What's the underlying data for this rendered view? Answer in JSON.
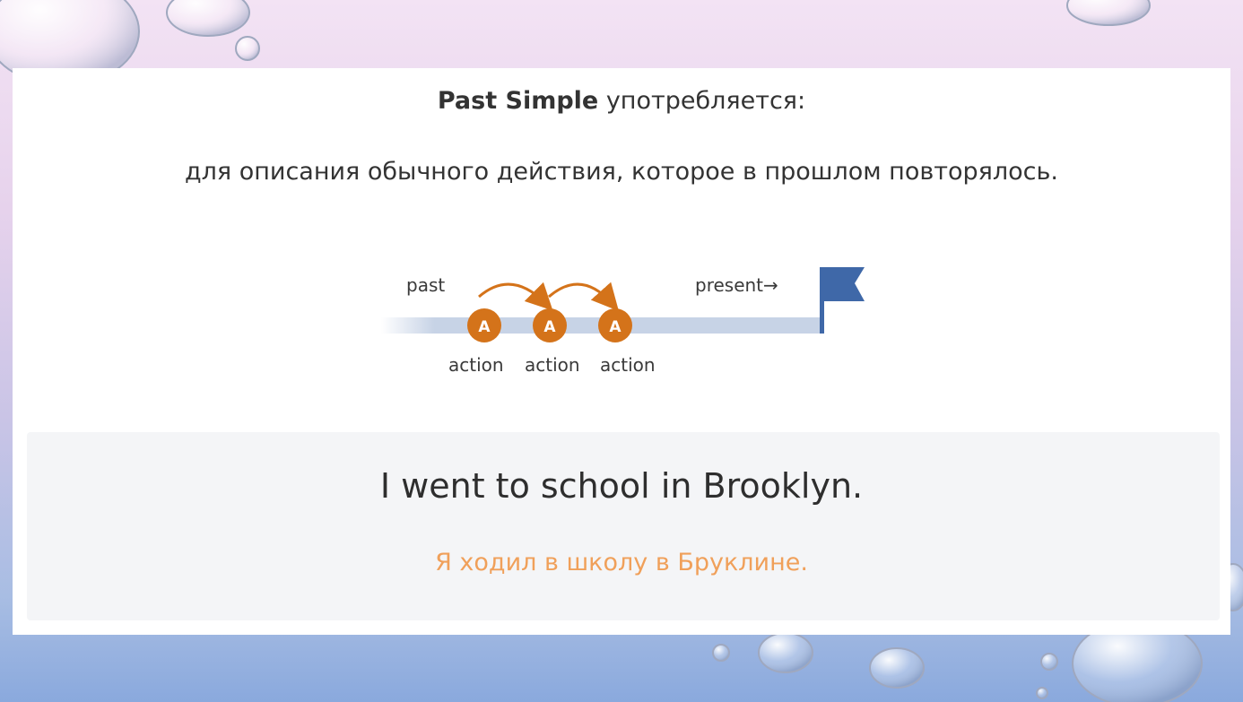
{
  "slide": {
    "heading_bold": "Past Simple",
    "heading_rest": "употребляется:",
    "description": "для описания обычного действия, которое в прошлом повторялось."
  },
  "timeline": {
    "past_label": "past",
    "present_label": "present→",
    "marker_letter": "A",
    "actions": [
      "action",
      "action",
      "action"
    ],
    "colors": {
      "action": "#d4731a",
      "line": "#c7d3e6",
      "flag": "#3f68a8"
    },
    "icon": "flag-icon"
  },
  "example": {
    "english": "I went to school in Brooklyn.",
    "russian": "Я ходил в школу в Бруклине."
  }
}
